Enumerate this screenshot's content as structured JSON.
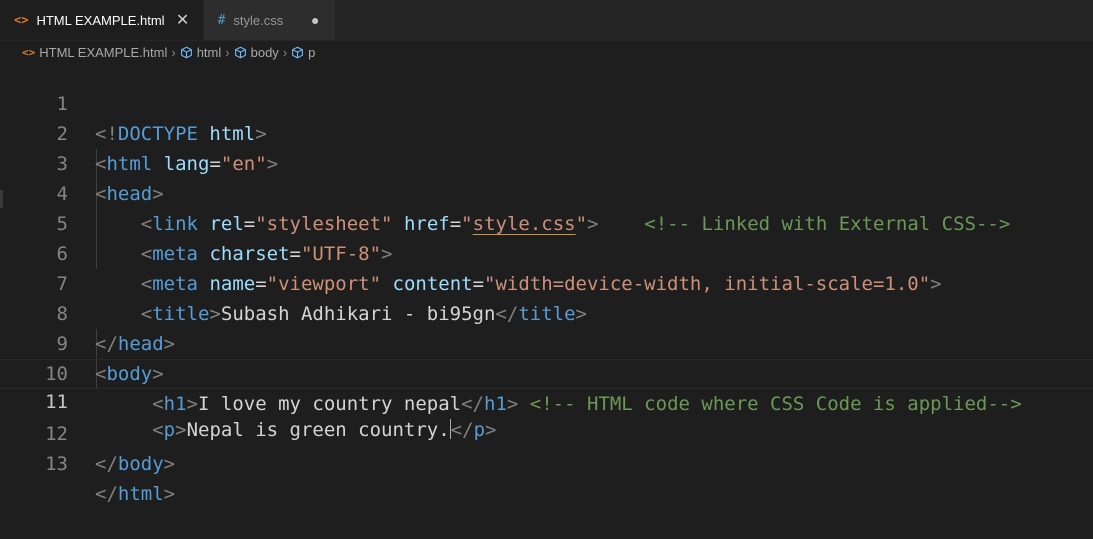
{
  "tabs": [
    {
      "icon": "<>",
      "label": "HTML EXAMPLE.html",
      "active": true,
      "close": "✕"
    },
    {
      "icon": "#",
      "label": "style.css",
      "active": false,
      "dirty": "●"
    }
  ],
  "breadcrumb": {
    "file": "HTML EXAMPLE.html",
    "items": [
      "html",
      "body",
      "p"
    ]
  },
  "lines": [
    {
      "num": "1"
    },
    {
      "num": "2"
    },
    {
      "num": "3"
    },
    {
      "num": "4"
    },
    {
      "num": "5"
    },
    {
      "num": "6"
    },
    {
      "num": "7"
    },
    {
      "num": "8"
    },
    {
      "num": "9"
    },
    {
      "num": "10"
    },
    {
      "num": "11"
    },
    {
      "num": "12"
    },
    {
      "num": "13"
    }
  ],
  "code": {
    "l1": {
      "open": "<!",
      "doctype": "DOCTYPE",
      "html": "html",
      "close": ">"
    },
    "l2": {
      "open": "<",
      "tag": "html",
      "attr": "lang",
      "eq": "=",
      "val": "\"en\"",
      "close": ">"
    },
    "l3": {
      "open": "<",
      "tag": "head",
      "close": ">"
    },
    "l4": {
      "open": "<",
      "tag": "link",
      "attr1": "rel",
      "eq": "=",
      "val1": "\"stylesheet\"",
      "attr2": "href",
      "val2a": "\"",
      "val2b": "style.css",
      "val2c": "\"",
      "close": ">",
      "comment": "<!-- Linked with External CSS-->"
    },
    "l5": {
      "open": "<",
      "tag": "meta",
      "attr": "charset",
      "eq": "=",
      "val": "\"UTF-8\"",
      "close": ">"
    },
    "l6": {
      "open": "<",
      "tag": "meta",
      "attr1": "name",
      "eq": "=",
      "val1": "\"viewport\"",
      "attr2": "content",
      "val2": "\"width=device-width, initial-scale=1.0\"",
      "close": ">"
    },
    "l7": {
      "open": "<",
      "tag": "title",
      "close": ">",
      "text": "Subash Adhikari - bi95gn",
      "endopen": "</"
    },
    "l8": {
      "endopen": "</",
      "tag": "head",
      "close": ">"
    },
    "l9": {
      "open": "<",
      "tag": "body",
      "close": ">"
    },
    "l10": {
      "open": "<",
      "tag": "h1",
      "close": ">",
      "text": "I love my country nepal",
      "endopen": "</",
      "comment": "<!-- HTML code where CSS Code is applied-->"
    },
    "l11": {
      "open": "<",
      "tag": "p",
      "close": ">",
      "text": "Nepal is green country.",
      "endopen": "</"
    },
    "l12": {
      "endopen": "</",
      "tag": "body",
      "close": ">"
    },
    "l13": {
      "endopen": "</",
      "tag": "html",
      "close": ">"
    }
  },
  "colors": {
    "background": "#1e1e1e",
    "tag": "#569cd6",
    "attribute": "#9cdcfe",
    "string": "#ce9178",
    "comment": "#6a9955",
    "bracket": "#808080"
  }
}
